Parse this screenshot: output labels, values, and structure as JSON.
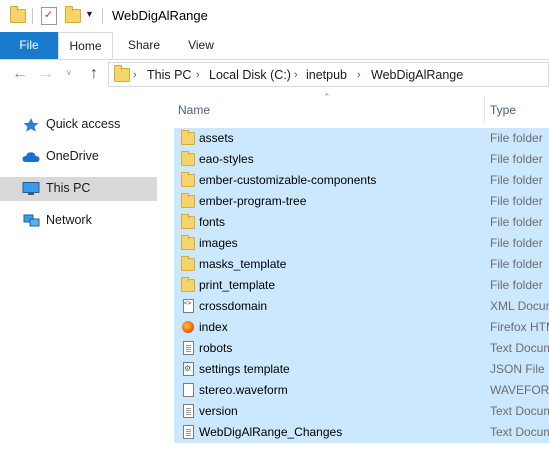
{
  "window": {
    "title": "WebDigAlRange"
  },
  "ribbon": {
    "tabs": [
      {
        "label": "File"
      },
      {
        "label": "Home"
      },
      {
        "label": "Share"
      },
      {
        "label": "View"
      }
    ]
  },
  "address": {
    "breadcrumbs": [
      "This PC",
      "Local Disk (C:)",
      "inetpub",
      "WebDigAlRange"
    ]
  },
  "nav_pane": {
    "items": [
      {
        "label": "Quick access",
        "icon": "star-icon"
      },
      {
        "label": "OneDrive",
        "icon": "cloud-icon"
      },
      {
        "label": "This PC",
        "icon": "computer-icon",
        "selected": true
      },
      {
        "label": "Network",
        "icon": "network-icon"
      }
    ]
  },
  "columns": {
    "name": "Name",
    "type": "Type"
  },
  "files": [
    {
      "name": "assets",
      "type": "File folder",
      "icon": "folder-icon"
    },
    {
      "name": "eao-styles",
      "type": "File folder",
      "icon": "folder-icon"
    },
    {
      "name": "ember-customizable-components",
      "type": "File folder",
      "icon": "folder-icon"
    },
    {
      "name": "ember-program-tree",
      "type": "File folder",
      "icon": "folder-icon"
    },
    {
      "name": "fonts",
      "type": "File folder",
      "icon": "folder-icon"
    },
    {
      "name": "images",
      "type": "File folder",
      "icon": "folder-icon"
    },
    {
      "name": "masks_template",
      "type": "File folder",
      "icon": "folder-icon"
    },
    {
      "name": "print_template",
      "type": "File folder",
      "icon": "folder-icon"
    },
    {
      "name": "crossdomain",
      "type": "XML Docum",
      "icon": "xml-file-icon"
    },
    {
      "name": "index",
      "type": "Firefox HTM",
      "icon": "firefox-html-icon"
    },
    {
      "name": "robots",
      "type": "Text Docum",
      "icon": "text-file-icon"
    },
    {
      "name": "settings template",
      "type": "JSON File",
      "icon": "json-file-icon"
    },
    {
      "name": "stereo.waveform",
      "type": "WAVEFORM",
      "icon": "blank-file-icon"
    },
    {
      "name": "version",
      "type": "Text Docum",
      "icon": "text-file-icon"
    },
    {
      "name": "WebDigAlRange_Changes",
      "type": "Text Docum",
      "icon": "text-file-icon"
    }
  ],
  "colors": {
    "selection": "#cce8ff",
    "file_tab": "#1979ca",
    "folder": "#f6d36b"
  }
}
